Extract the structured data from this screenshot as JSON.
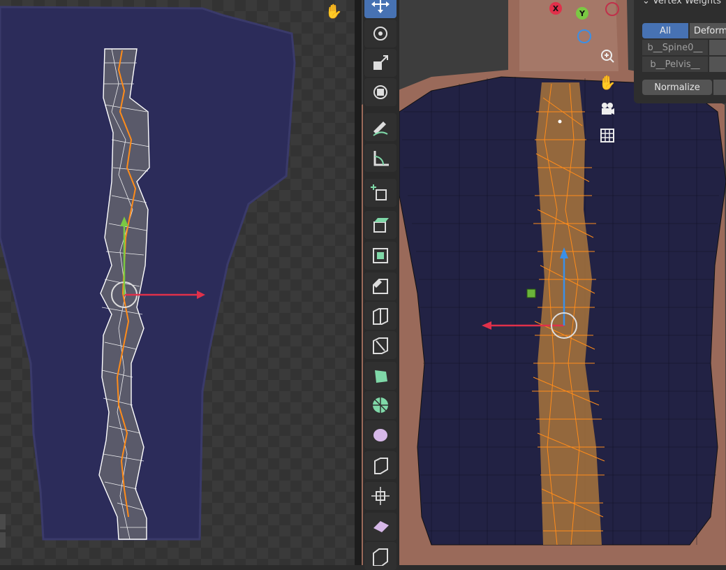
{
  "panel": {
    "title": "Vertex Weights",
    "filter_all": "All",
    "filter_deform": "Deform",
    "groups": [
      "b__Spine0__",
      "b__Pelvis__"
    ],
    "normalize_label": "Normalize"
  },
  "navigation": {
    "axes": {
      "x": "X",
      "y": "Y"
    }
  },
  "toolbar": {
    "tools": [
      "move-icon",
      "rotate-icon",
      "scale-icon",
      "transform-icon",
      "annotate-icon",
      "measure-icon",
      "add-cube-icon",
      "extrude-icon",
      "inset-icon",
      "bevel-icon",
      "loop-cut-icon",
      "knife-icon",
      "poly-build-icon",
      "spin-icon",
      "smooth-icon",
      "edge-slide-icon",
      "shrink-fatten-icon",
      "shear-icon",
      "rip-icon"
    ]
  },
  "colors": {
    "accent": "#4772b3",
    "selection": "#ff8c1a",
    "garment": "#2a2a55",
    "gizmo_x": "#e0304a",
    "gizmo_y": "#7ac943",
    "gizmo_z": "#3b8fe6"
  }
}
